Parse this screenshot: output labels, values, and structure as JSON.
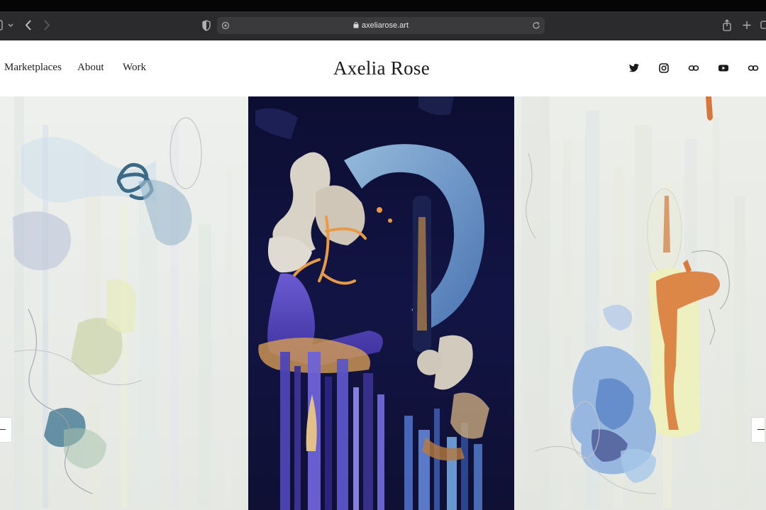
{
  "browser": {
    "url": "axeliarose.art",
    "icons": [
      "sidebar-icon",
      "chevron-down-icon",
      "back-icon",
      "forward-icon",
      "privacy-shield-icon",
      "page-settings-icon",
      "lock-icon",
      "reload-icon",
      "share-icon",
      "new-tab-icon",
      "tab-overview-icon"
    ]
  },
  "site": {
    "nav": [
      {
        "label": "Marketplaces"
      },
      {
        "label": "About"
      },
      {
        "label": "Work"
      }
    ],
    "brand": "Axelia Rose",
    "social": [
      "twitter-icon",
      "instagram-icon",
      "link-icon",
      "youtube-icon",
      "link-icon"
    ]
  },
  "gallery": {
    "artworks": [
      "artwork-left",
      "artwork-center",
      "artwork-right"
    ],
    "controls": [
      "prev-arrow",
      "next-arrow"
    ]
  },
  "colors": {
    "toolbar": "#2b2b2d",
    "header": "#ffffff",
    "center_art_bg": "#10103a",
    "side_art_bg": "#e8e9e6"
  }
}
